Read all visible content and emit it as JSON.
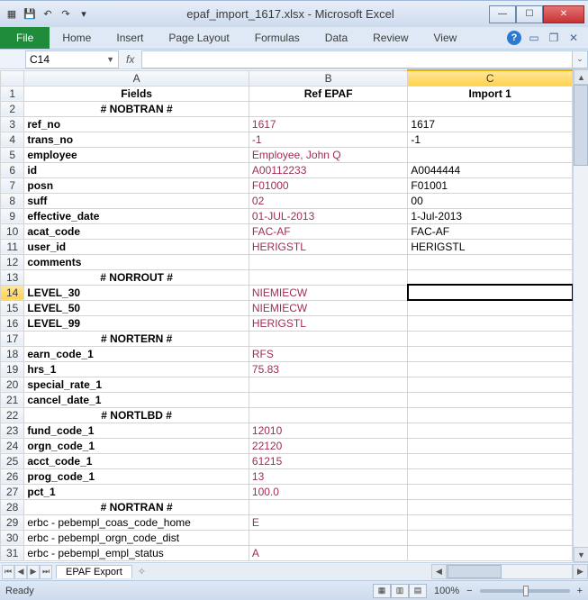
{
  "title": "epaf_import_1617.xlsx - Microsoft Excel",
  "qat": {
    "save": "💾",
    "undo": "↶",
    "redo": "↷"
  },
  "ribbon": {
    "file": "File",
    "tabs": [
      "Home",
      "Insert",
      "Page Layout",
      "Formulas",
      "Data",
      "Review",
      "View"
    ]
  },
  "namebox": "C14",
  "fx": "fx",
  "columns": [
    "A",
    "B",
    "C"
  ],
  "headers": {
    "A": "Fields",
    "B": "Ref EPAF",
    "C": "Import 1"
  },
  "rows": [
    {
      "n": 2,
      "a": "# NOBTRAN #",
      "a_bold": true,
      "a_center": true
    },
    {
      "n": 3,
      "a": "ref_no",
      "a_bold": true,
      "b": "1617",
      "c": "1617",
      "maroon": true
    },
    {
      "n": 4,
      "a": "trans_no",
      "a_bold": true,
      "b": "-1",
      "c": "-1",
      "maroon": true
    },
    {
      "n": 5,
      "a": "employee",
      "a_bold": true,
      "b": "Employee, John Q",
      "maroon": true
    },
    {
      "n": 6,
      "a": "id",
      "a_bold": true,
      "b": "A00112233",
      "c": "A0044444",
      "maroon": true
    },
    {
      "n": 7,
      "a": "posn",
      "a_bold": true,
      "b": "F01000",
      "c": "F01001",
      "maroon": true
    },
    {
      "n": 8,
      "a": "suff",
      "a_bold": true,
      "b": "02",
      "c": "00",
      "maroon": true
    },
    {
      "n": 9,
      "a": "effective_date",
      "a_bold": true,
      "b": "01-JUL-2013",
      "c": "1-Jul-2013",
      "maroon": true
    },
    {
      "n": 10,
      "a": "acat_code",
      "a_bold": true,
      "b": "FAC-AF",
      "c": "FAC-AF",
      "maroon": true
    },
    {
      "n": 11,
      "a": "user_id",
      "a_bold": true,
      "b": "HERIGSTL",
      "c": "HERIGSTL",
      "maroon": true
    },
    {
      "n": 12,
      "a": "comments",
      "a_bold": true
    },
    {
      "n": 13,
      "a": "# NORROUT #",
      "a_bold": true,
      "a_center": true
    },
    {
      "n": 14,
      "a": "LEVEL_30",
      "a_bold": true,
      "b": "NIEMIECW",
      "maroon": true,
      "active": true
    },
    {
      "n": 15,
      "a": "LEVEL_50",
      "a_bold": true,
      "b": "NIEMIECW",
      "maroon": true
    },
    {
      "n": 16,
      "a": "LEVEL_99",
      "a_bold": true,
      "b": "HERIGSTL",
      "maroon": true
    },
    {
      "n": 17,
      "a": "# NORTERN #",
      "a_bold": true,
      "a_center": true
    },
    {
      "n": 18,
      "a": "earn_code_1",
      "a_bold": true,
      "b": "RFS",
      "maroon": true
    },
    {
      "n": 19,
      "a": "hrs_1",
      "a_bold": true,
      "b": "75.83",
      "maroon": true
    },
    {
      "n": 20,
      "a": "special_rate_1",
      "a_bold": true
    },
    {
      "n": 21,
      "a": "cancel_date_1",
      "a_bold": true
    },
    {
      "n": 22,
      "a": "# NORTLBD #",
      "a_bold": true,
      "a_center": true
    },
    {
      "n": 23,
      "a": "fund_code_1",
      "a_bold": true,
      "b": "12010",
      "maroon": true
    },
    {
      "n": 24,
      "a": "orgn_code_1",
      "a_bold": true,
      "b": "22120",
      "maroon": true
    },
    {
      "n": 25,
      "a": "acct_code_1",
      "a_bold": true,
      "b": "61215",
      "maroon": true
    },
    {
      "n": 26,
      "a": "prog_code_1",
      "a_bold": true,
      "b": "13",
      "maroon": true
    },
    {
      "n": 27,
      "a": "pct_1",
      "a_bold": true,
      "b": "100.0",
      "maroon": true
    },
    {
      "n": 28,
      "a": "# NORTRAN #",
      "a_bold": true,
      "a_center": true
    },
    {
      "n": 29,
      "a": "erbc - pebempl_coas_code_home",
      "b": "E",
      "maroon": true
    },
    {
      "n": 30,
      "a": "erbc - pebempl_orgn_code_dist"
    },
    {
      "n": 31,
      "a": "erbc - pebempl_empl_status",
      "b": "A",
      "maroon": true
    }
  ],
  "sheet_tab": "EPAF Export",
  "status": {
    "ready": "Ready",
    "zoom": "100%"
  }
}
